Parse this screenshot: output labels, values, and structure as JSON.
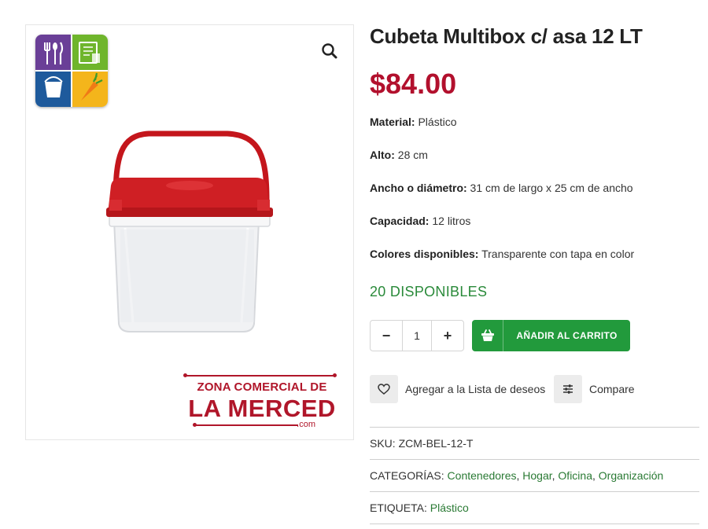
{
  "product": {
    "title": "Cubeta Multibox c/ asa 12 LT",
    "price": "$84.00",
    "attributes": [
      {
        "label": "Material:",
        "value": " Plástico"
      },
      {
        "label": "Alto:",
        "value": " 28 cm"
      },
      {
        "label": "Ancho o diámetro:",
        "value": " 31 cm de largo x 25 cm de ancho"
      },
      {
        "label": "Capacidad:",
        "value": " 12 litros"
      },
      {
        "label": "Colores disponibles:",
        "value": " Transparente con tapa en color"
      }
    ],
    "stock": "20 DISPONIBLES"
  },
  "cart": {
    "minus": "−",
    "plus": "+",
    "quantity": "1",
    "add_label": "AÑADIR AL CARRITO"
  },
  "actions": {
    "wishlist": "Agregar a la Lista de deseos",
    "compare": "Compare"
  },
  "meta": {
    "sku_label": "SKU:",
    "sku_value": " ZCM-BEL-12-T",
    "categories_label": "CATEGORÍAS:",
    "categories": [
      "Contenedores",
      "Hogar",
      "Oficina",
      "Organización"
    ],
    "tag_label": "ETIQUETA:",
    "tag": "Plástico"
  },
  "brand": {
    "line1": "ZONA COMERCIAL DE",
    "line2": "LA MERCED",
    "line3": ".com"
  },
  "icons": {
    "zoom": "magnifier-icon",
    "cart": "basket-icon",
    "wishlist": "heart-icon",
    "compare": "sliders-icon"
  },
  "colors": {
    "price": "#b2102d",
    "stock": "#2a8a3a",
    "cart_button": "#229a3c",
    "brand": "#b0162a",
    "link": "#2a7a34"
  }
}
